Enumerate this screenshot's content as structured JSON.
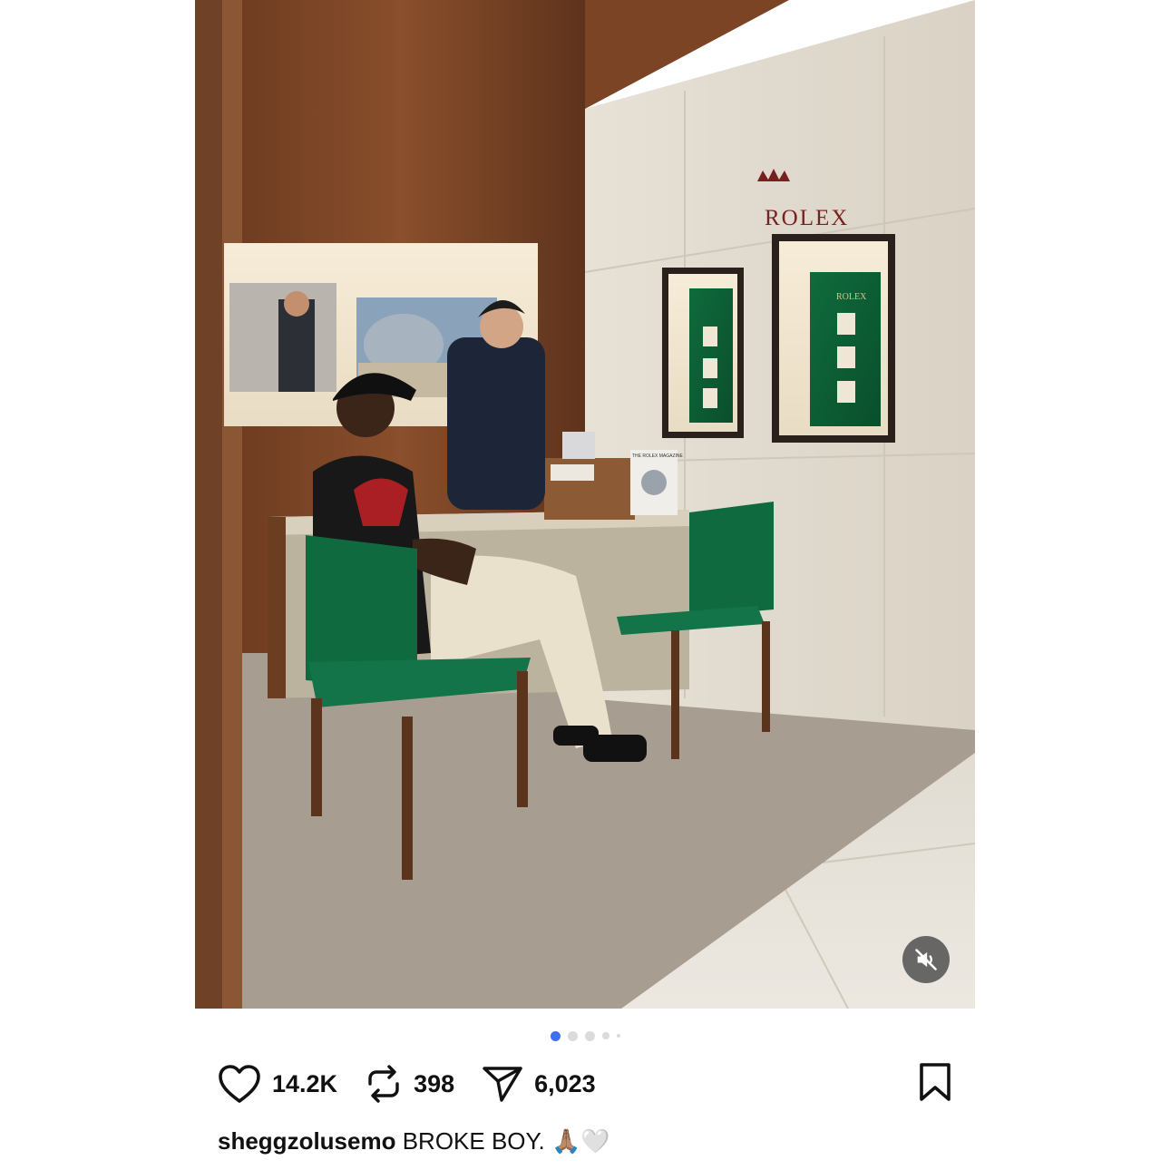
{
  "post": {
    "media": {
      "type": "photo",
      "wall_logo_text": "ROLEX",
      "case_logo_text": "ROLEX",
      "magazine_text": "THE ROLEX MAGAZINE"
    },
    "carousel": {
      "total_dots": 5,
      "active_index": 0
    },
    "actions": {
      "like_count": "14.2K",
      "repost_count": "398",
      "share_count": "6,023"
    },
    "caption": {
      "username": "sheggzolusemo",
      "text": "BROKE BOY.",
      "emoji": "🙏🏽🤍"
    }
  },
  "icons": {
    "like": "heart-icon",
    "repost": "repost-icon",
    "share": "send-icon",
    "bookmark": "bookmark-icon",
    "mute": "volume-muted-icon"
  },
  "colors": {
    "active_dot": "#3d6ef5",
    "inactive_dot": "#dbdbdb",
    "text": "#111111"
  }
}
